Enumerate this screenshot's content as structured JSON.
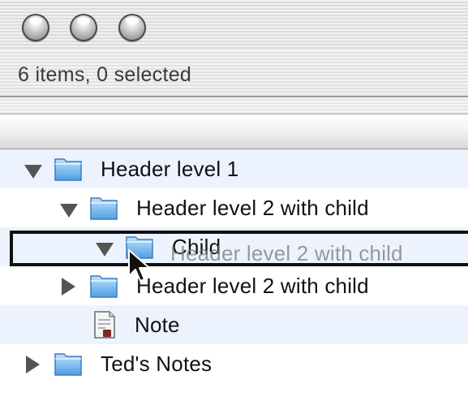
{
  "window": {
    "controls": [
      "close-button",
      "minimize-button",
      "zoom-button"
    ],
    "status_text": "6 items, 0 selected"
  },
  "outline": {
    "rows": [
      {
        "label": "Header level 1",
        "expanded": true,
        "icon": "folder-icon",
        "level": 1
      },
      {
        "label": "Header level 2 with child",
        "expanded": true,
        "icon": "folder-icon",
        "level": 2
      },
      {
        "label": "Child",
        "expanded": true,
        "icon": "folder-icon",
        "level": 3
      },
      {
        "label": "Header level 2 with child",
        "expanded": false,
        "icon": "folder-icon",
        "level": 2
      },
      {
        "label": "Note",
        "icon": "note-icon",
        "level": 2
      },
      {
        "label": "Ted's Notes",
        "expanded": false,
        "icon": "folder-icon",
        "level": 1
      }
    ]
  },
  "drag": {
    "ghost_label": "Header level 2 with child"
  },
  "colors": {
    "alt_row": "#edf3fe",
    "folder_blue": "#6fb4ec",
    "triangle": "#555555"
  }
}
